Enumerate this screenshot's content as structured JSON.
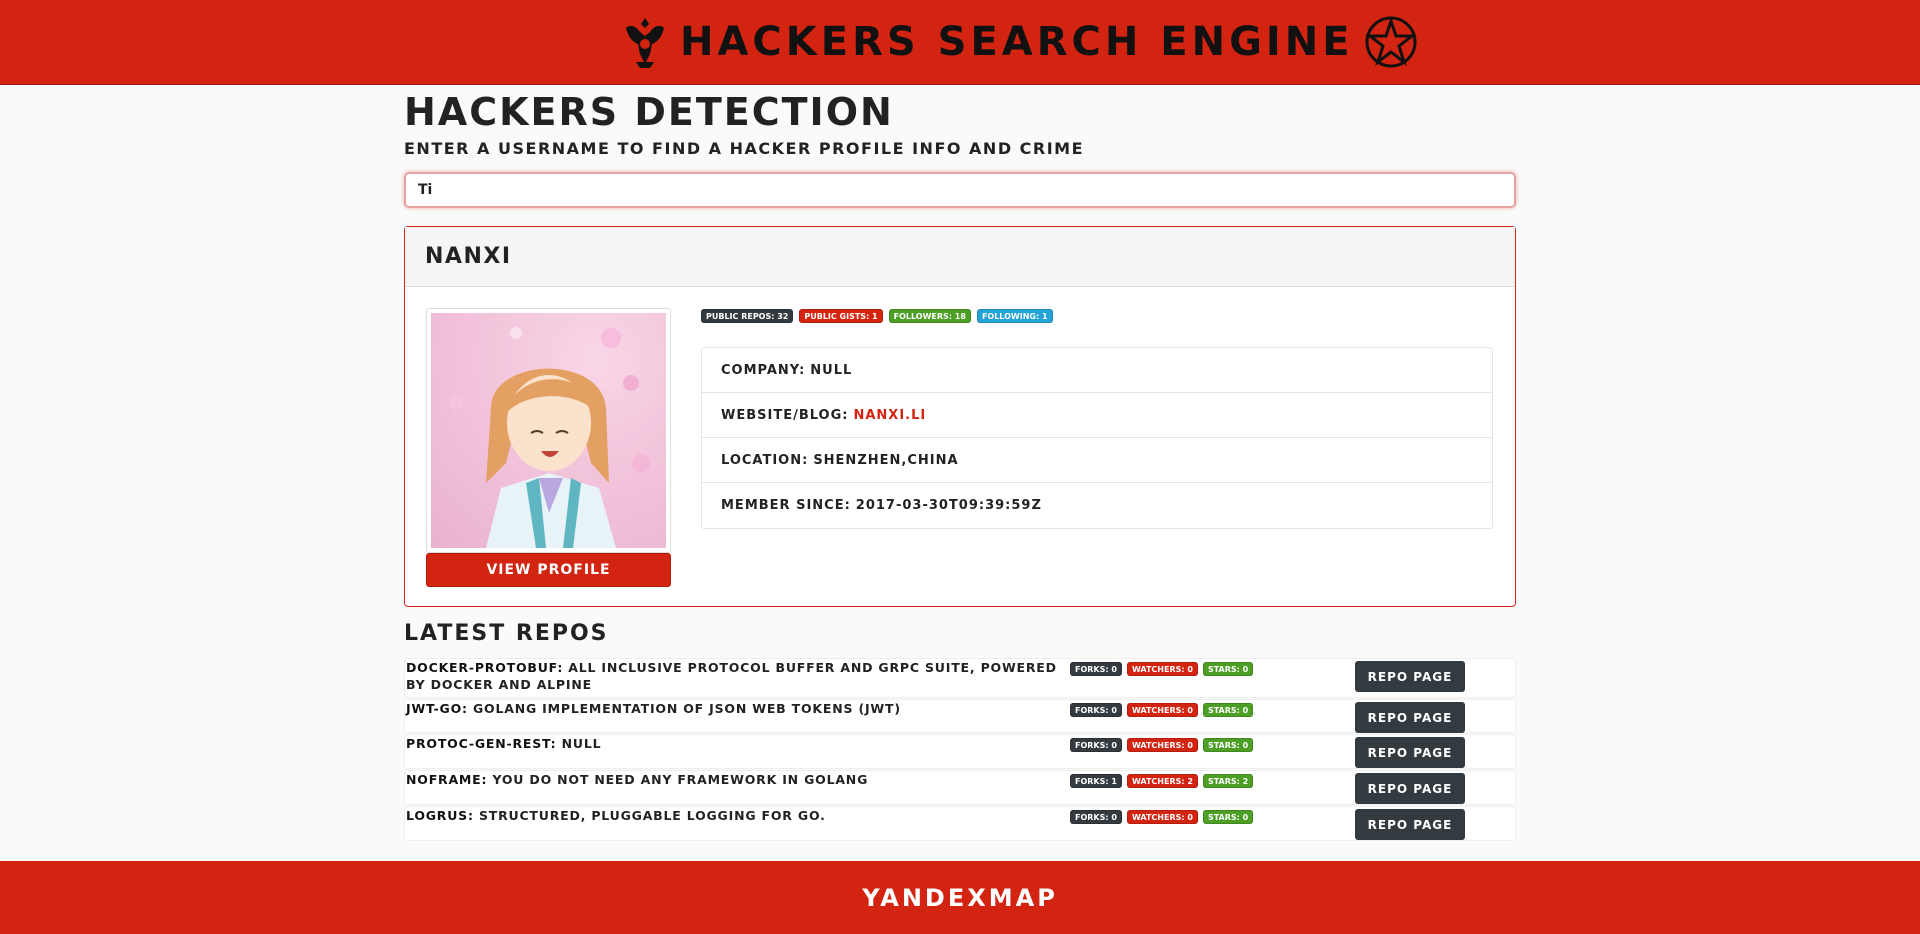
{
  "header": {
    "title": "HACKERS SEARCH ENGINE",
    "left_emblem": "double-headed-eagle-icon",
    "right_emblem": "star-icon"
  },
  "page": {
    "title": "HACKERS DETECTION",
    "subtitle": "ENTER A USERNAME TO FIND A HACKER PROFILE INFO AND CRIME"
  },
  "search": {
    "value": "Ti"
  },
  "profile": {
    "name": "NANXI",
    "view_label": "VIEW PROFILE",
    "badges": {
      "public_repos": "PUBLIC REPOS: 32",
      "public_gists": "PUBLIC GISTS: 1",
      "followers": "FOLLOWERS: 18",
      "following": "FOLLOWING: 1"
    },
    "company_label": "COMPANY:",
    "company": "NULL",
    "website_label": "WEBSITE/BLOG:",
    "website": "NANXI.LI",
    "location_label": "LOCATION:",
    "location": "SHENZHEN,CHINA",
    "member_since_label": "MEMBER SINCE:",
    "member_since": "2017-03-30T09:39:59Z"
  },
  "repos": {
    "title": "LATEST REPOS",
    "button_label": "REPO PAGE",
    "items": [
      {
        "name": "DOCKER-PROTOBUF:",
        "description": "ALL INCLUSIVE PROTOCOL BUFFER AND GRPC SUITE, POWERED BY DOCKER AND ALPINE",
        "forks": "FORKS: 0",
        "watchers": "WATCHERS: 0",
        "stars": "STARS: 0"
      },
      {
        "name": "JWT-GO:",
        "description": "GOLANG IMPLEMENTATION OF JSON WEB TOKENS (JWT)",
        "forks": "FORKS: 0",
        "watchers": "WATCHERS: 0",
        "stars": "STARS: 0"
      },
      {
        "name": "PROTOC-GEN-REST:",
        "description": "NULL",
        "forks": "FORKS: 0",
        "watchers": "WATCHERS: 0",
        "stars": "STARS: 0"
      },
      {
        "name": "NOFRAME:",
        "description": "YOU DO NOT NEED ANY FRAMEWORK IN GOLANG",
        "forks": "FORKS: 1",
        "watchers": "WATCHERS: 2",
        "stars": "STARS: 2"
      },
      {
        "name": "LOGRUS:",
        "description": "STRUCTURED, PLUGGABLE LOGGING FOR GO.",
        "forks": "FORKS: 0",
        "watchers": "WATCHERS: 0",
        "stars": "STARS: 0"
      }
    ]
  },
  "footer": {
    "text": "YANDEXMAP"
  },
  "colors": {
    "brand_red": "#d32412",
    "dark": "#333a40",
    "green": "#4c9f24",
    "blue": "#23a2d6"
  }
}
